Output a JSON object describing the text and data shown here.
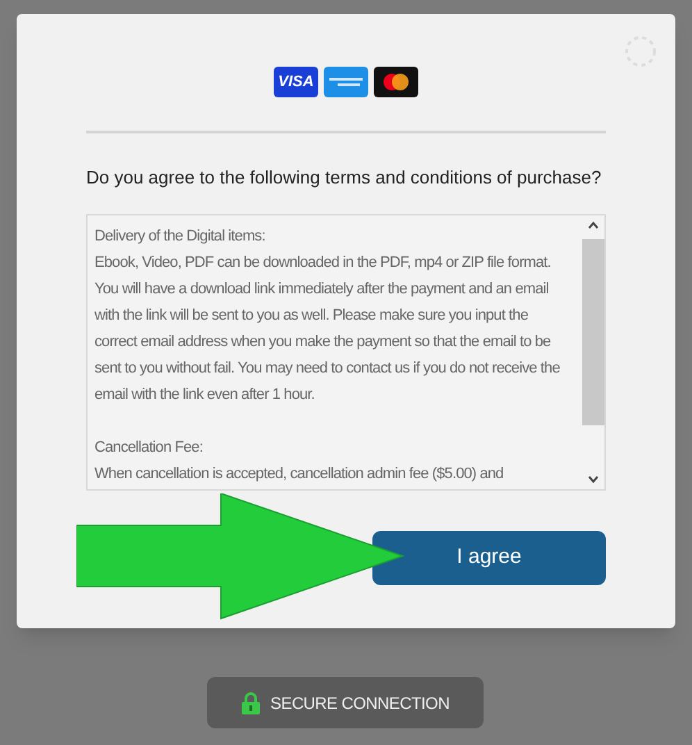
{
  "card_logos": [
    {
      "kind": "visa",
      "label": "VISA"
    },
    {
      "kind": "amex"
    },
    {
      "kind": "mastercard"
    }
  ],
  "question": "Do you agree to the following terms and conditions of purchase?",
  "terms": [
    {
      "heading": "Delivery of the Digital items:",
      "body": "Ebook, Video, PDF can be downloaded in the PDF, mp4 or ZIP file format. You will have a download link immediately after the payment and an email with the link will be sent to you as well. Please make sure you input the correct email address when you make the payment so that the email to be sent to you without fail. You may need to contact us if you do not receive the email with the link even after 1 hour."
    },
    {
      "heading": "Cancellation Fee:",
      "body": "When cancellation is accepted, cancellation admin fee ($5.00) and"
    }
  ],
  "agree_button": "I agree",
  "secure_badge": "SECURE CONNECTION"
}
